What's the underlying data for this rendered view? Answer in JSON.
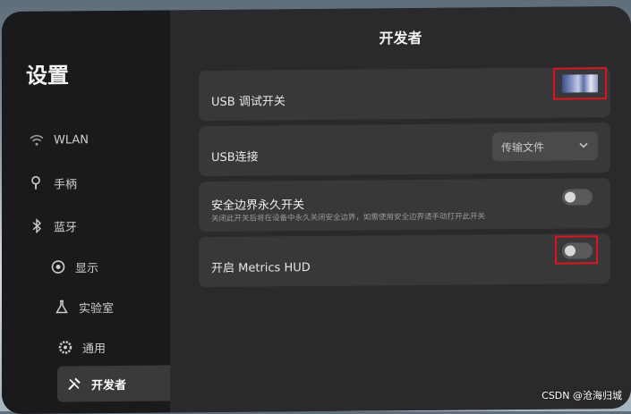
{
  "sidebar": {
    "title": "设置",
    "items": [
      {
        "label": "WLAN",
        "icon": "wifi-icon"
      },
      {
        "label": "手柄",
        "icon": "controller-icon"
      },
      {
        "label": "蓝牙",
        "icon": "bluetooth-icon"
      },
      {
        "label": "显示",
        "icon": "eye-icon"
      },
      {
        "label": "实验室",
        "icon": "flask-icon"
      },
      {
        "label": "通用",
        "icon": "gear-icon"
      },
      {
        "label": "开发者",
        "icon": "tools-icon",
        "active": true
      }
    ]
  },
  "main": {
    "title": "开发者",
    "rows": {
      "usb_debug": {
        "label": "USB 调试开关"
      },
      "usb_connection": {
        "label": "USB连接",
        "selected": "传输文件"
      },
      "boundary": {
        "title": "安全边界永久开关",
        "description": "关闭此开关后将在设备中永久关闭安全边界，如需使用安全边界请手动打开此开关",
        "toggle_on": false
      },
      "metrics": {
        "label": "开启 Metrics HUD",
        "toggle_on": false
      }
    }
  },
  "watermark": "CSDN @沧海归城",
  "colors": {
    "highlight": "#e0141e",
    "panel": "#1f1f21",
    "row": "#38383b"
  }
}
